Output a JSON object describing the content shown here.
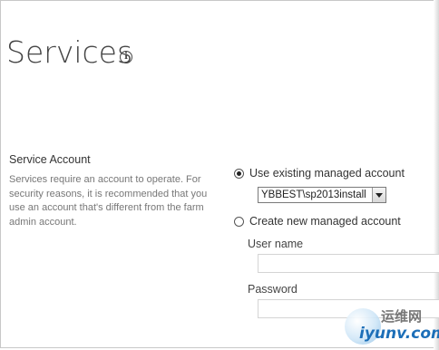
{
  "page": {
    "title": "Services",
    "info_icon": "info-icon"
  },
  "service_account": {
    "heading": "Service Account",
    "description": "Services require an account to operate. For security reasons, it is recommended that you use an account that's different from the farm admin account."
  },
  "options": {
    "existing_label": "Use existing managed account",
    "existing_selected": true,
    "account_value": "YBBEST\\sp2013install",
    "new_label": "Create new managed account",
    "new_selected": false
  },
  "fields": {
    "username_label": "User name",
    "username_value": "",
    "password_label": "Password",
    "password_value": ""
  },
  "watermark": {
    "cn": "运维网",
    "en": "iyunv.com"
  },
  "colors": {
    "title": "#444444",
    "description": "#777777",
    "watermark_blue": "#1d6fb8"
  }
}
